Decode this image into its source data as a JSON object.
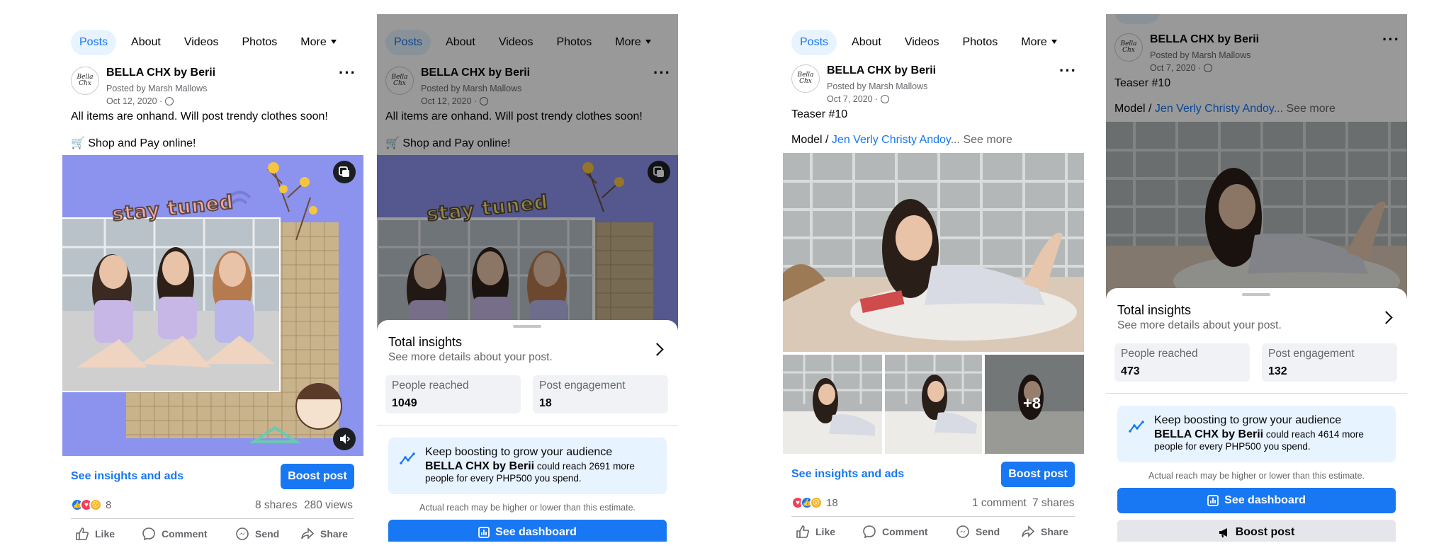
{
  "tabs": [
    "Posts",
    "About",
    "Videos",
    "Photos",
    "More"
  ],
  "post1": {
    "page_name": "BELLA CHX by Berii",
    "avatar_text": "Bella Chx",
    "posted_by": "Posted by Marsh Mallows",
    "date": "Oct 12, 2020 ·",
    "line1": "All items are onhand. Will post trendy clothes soon!",
    "line2": "🛒 Shop and Pay online!",
    "image_text": "stay tuned",
    "insights_link": "See insights and ads",
    "boost_label": "Boost post",
    "reaction_count": "8",
    "shares": "8 shares",
    "views": "280 views"
  },
  "post2": {
    "page_name": "BELLA CHX by Berii",
    "avatar_text": "Bella Chx",
    "posted_by": "Posted by Marsh Mallows",
    "date": "Oct 7, 2020 ·",
    "line1": "Teaser #10",
    "model_prefix": "Model / ",
    "model_name": "Jen Verly Christy Andoy",
    "see_more": "... See more",
    "more_photos": "+8",
    "insights_link": "See insights and ads",
    "boost_label": "Boost post",
    "reaction_count": "18",
    "comments": "1 comment",
    "shares": "7 shares"
  },
  "actions": [
    "Like",
    "Comment",
    "Send",
    "Share"
  ],
  "sheet1": {
    "title": "Total insights",
    "subtitle": "See more details about your post.",
    "reached_label": "People reached",
    "reached_value": "1049",
    "engagement_label": "Post engagement",
    "engagement_value": "18",
    "boost_title": "Keep boosting to grow your audience",
    "boost_page": "BELLA CHX by Berii",
    "boost_body": " could reach 2691 more people for every PHP500 you spend.",
    "note": "Actual reach may be higher or lower than this estimate.",
    "dashboard": "See dashboard"
  },
  "sheet2": {
    "title": "Total insights",
    "subtitle": "See more details about your post.",
    "reached_label": "People reached",
    "reached_value": "473",
    "engagement_label": "Post engagement",
    "engagement_value": "132",
    "boost_title": "Keep boosting to grow your audience",
    "boost_page": "BELLA CHX by Berii",
    "boost_body": " could reach 4614 more people for every PHP500 you spend.",
    "note": "Actual reach may be higher or lower than this estimate.",
    "dashboard": "See dashboard",
    "boost_post": "Boost post"
  },
  "colors": {
    "brand": "#1877f2",
    "active_tab_bg": "#e7f3ff",
    "sheet_box": "#e7f3ff",
    "metric_bg": "#f0f2f5",
    "image1_bg": "#8c93ee"
  }
}
